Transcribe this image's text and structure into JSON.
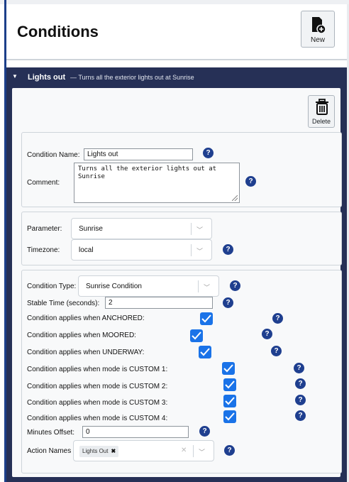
{
  "page": {
    "title": "Conditions",
    "new_label": "New"
  },
  "panel": {
    "caret": "▼",
    "name": "Lights out",
    "dash_desc": "— Turns all the exterior lights out at Sunrise",
    "delete_label": "Delete"
  },
  "group1": {
    "name_label": "Condition Name:",
    "name_value": "Lights out",
    "comment_label": "Comment:",
    "comment_value": "Turns all the exterior lights out at Sunrise"
  },
  "group2": {
    "parameter_label": "Parameter:",
    "parameter_value": "Sunrise",
    "timezone_label": "Timezone:",
    "timezone_value": "local"
  },
  "group3": {
    "type_label": "Condition Type:",
    "type_value": "Sunrise Condition",
    "stable_label": "Stable Time (seconds):",
    "stable_value": "2",
    "applies": [
      {
        "label": "Condition applies when ANCHORED:",
        "checked": true
      },
      {
        "label": "Condition applies when MOORED:",
        "checked": true
      },
      {
        "label": "Condition applies when UNDERWAY:",
        "checked": true
      },
      {
        "label": "Condition applies when mode is CUSTOM 1:",
        "checked": true
      },
      {
        "label": "Condition applies when mode is CUSTOM 2:",
        "checked": true
      },
      {
        "label": "Condition applies when mode is CUSTOM 3:",
        "checked": true
      },
      {
        "label": "Condition applies when mode is CUSTOM 4:",
        "checked": true
      }
    ],
    "minutes_label": "Minutes Offset:",
    "minutes_value": "0",
    "actions_label": "Action Names",
    "action_chip": "Lights Out",
    "chip_remove": "✖",
    "clear_symbol": "✕"
  },
  "icons": {
    "help": "?",
    "chevron": "﹀"
  },
  "colors": {
    "panel_header": "#263056",
    "help_icon": "#1f3f8f",
    "checkbox": "#1a73e8"
  }
}
